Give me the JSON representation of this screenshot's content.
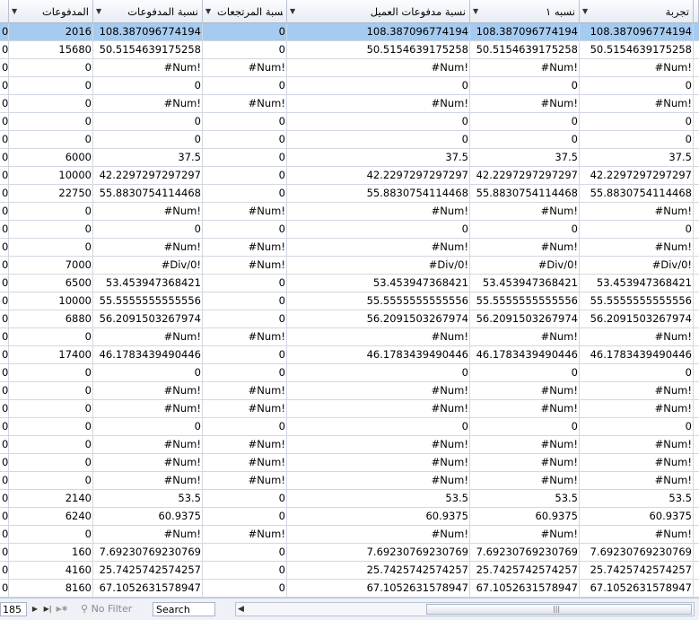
{
  "columns": [
    {
      "label": "المدفوعات"
    },
    {
      "label": "نسبة المدفوعات"
    },
    {
      "label": "نسبة المرتجعات"
    },
    {
      "label": "نسبة مدفوعات العميل"
    },
    {
      "label": "نسبه ١"
    },
    {
      "label": "تجربة"
    }
  ],
  "rows": [
    [
      "0",
      "2016",
      "108.387096774194",
      "0",
      "108.387096774194",
      "108.387096774194",
      "108.387096774194"
    ],
    [
      "0",
      "15680",
      "50.5154639175258",
      "0",
      "50.5154639175258",
      "50.5154639175258",
      "50.5154639175258"
    ],
    [
      "0",
      "0",
      "#Num!",
      "#Num!",
      "#Num!",
      "#Num!",
      "#Num!"
    ],
    [
      "0",
      "0",
      "0",
      "0",
      "0",
      "0",
      "0"
    ],
    [
      "0",
      "0",
      "#Num!",
      "#Num!",
      "#Num!",
      "#Num!",
      "#Num!"
    ],
    [
      "0",
      "0",
      "0",
      "0",
      "0",
      "0",
      "0"
    ],
    [
      "0",
      "0",
      "0",
      "0",
      "0",
      "0",
      "0"
    ],
    [
      "0",
      "6000",
      "37.5",
      "0",
      "37.5",
      "37.5",
      "37.5"
    ],
    [
      "0",
      "10000",
      "42.2297297297297",
      "0",
      "42.2297297297297",
      "42.2297297297297",
      "42.2297297297297"
    ],
    [
      "0",
      "22750",
      "55.8830754114468",
      "0",
      "55.8830754114468",
      "55.8830754114468",
      "55.8830754114468"
    ],
    [
      "0",
      "0",
      "#Num!",
      "#Num!",
      "#Num!",
      "#Num!",
      "#Num!"
    ],
    [
      "0",
      "0",
      "0",
      "0",
      "0",
      "0",
      "0"
    ],
    [
      "0",
      "0",
      "#Num!",
      "#Num!",
      "#Num!",
      "#Num!",
      "#Num!"
    ],
    [
      "0",
      "7000",
      "#Div/0!",
      "#Num!",
      "#Div/0!",
      "#Div/0!",
      "#Div/0!"
    ],
    [
      "0",
      "6500",
      "53.453947368421",
      "0",
      "53.453947368421",
      "53.453947368421",
      "53.453947368421"
    ],
    [
      "0",
      "10000",
      "55.5555555555556",
      "0",
      "55.5555555555556",
      "55.5555555555556",
      "55.5555555555556"
    ],
    [
      "0",
      "6880",
      "56.2091503267974",
      "0",
      "56.2091503267974",
      "56.2091503267974",
      "56.2091503267974"
    ],
    [
      "0",
      "0",
      "#Num!",
      "#Num!",
      "#Num!",
      "#Num!",
      "#Num!"
    ],
    [
      "0",
      "17400",
      "46.1783439490446",
      "0",
      "46.1783439490446",
      "46.1783439490446",
      "46.1783439490446"
    ],
    [
      "0",
      "0",
      "0",
      "0",
      "0",
      "0",
      "0"
    ],
    [
      "0",
      "0",
      "#Num!",
      "#Num!",
      "#Num!",
      "#Num!",
      "#Num!"
    ],
    [
      "0",
      "0",
      "#Num!",
      "#Num!",
      "#Num!",
      "#Num!",
      "#Num!"
    ],
    [
      "0",
      "0",
      "0",
      "0",
      "0",
      "0",
      "0"
    ],
    [
      "0",
      "0",
      "#Num!",
      "#Num!",
      "#Num!",
      "#Num!",
      "#Num!"
    ],
    [
      "0",
      "0",
      "#Num!",
      "#Num!",
      "#Num!",
      "#Num!",
      "#Num!"
    ],
    [
      "0",
      "0",
      "#Num!",
      "#Num!",
      "#Num!",
      "#Num!",
      "#Num!"
    ],
    [
      "0",
      "2140",
      "53.5",
      "0",
      "53.5",
      "53.5",
      "53.5"
    ],
    [
      "0",
      "6240",
      "60.9375",
      "0",
      "60.9375",
      "60.9375",
      "60.9375"
    ],
    [
      "0",
      "0",
      "#Num!",
      "#Num!",
      "#Num!",
      "#Num!",
      "#Num!"
    ],
    [
      "0",
      "160",
      "7.69230769230769",
      "0",
      "7.69230769230769",
      "7.69230769230769",
      "7.69230769230769"
    ],
    [
      "0",
      "4160",
      "25.7425742574257",
      "0",
      "25.7425742574257",
      "25.7425742574257",
      "25.7425742574257"
    ],
    [
      "0",
      "8160",
      "67.1052631578947",
      "0",
      "67.1052631578947",
      "67.1052631578947",
      "67.1052631578947"
    ]
  ],
  "footer": {
    "record_number": "185",
    "filter_label": "No Filter",
    "search_label": "Search"
  },
  "colors": {
    "selected_row": "#a6cbf1",
    "gridline": "#d2d8e2"
  }
}
